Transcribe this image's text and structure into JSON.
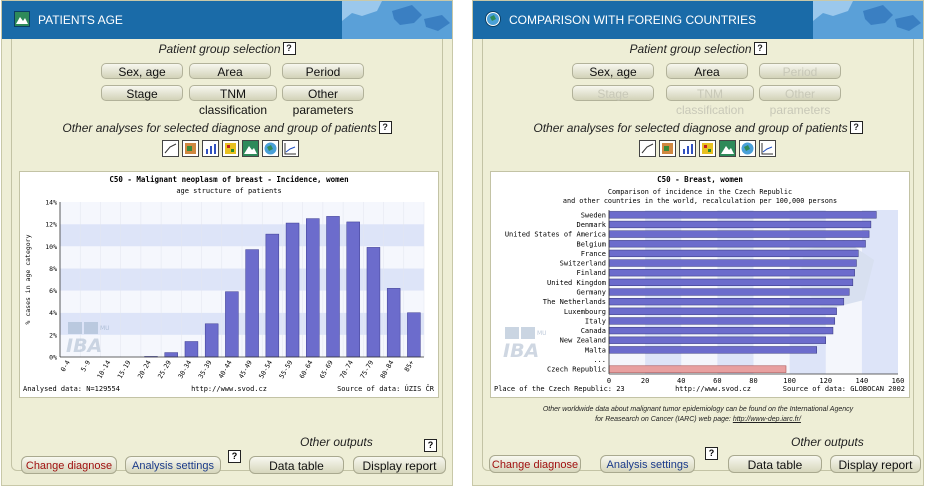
{
  "left": {
    "title": "PATIENTS AGE",
    "group_label": "Patient group selection",
    "group_buttons": [
      "Sex, age",
      "Area",
      "Period",
      "Stage",
      "TNM classification",
      "Other parameters"
    ],
    "analyses_label": "Other analyses for selected diagnose and group of patients",
    "footer": {
      "left": "Analysed data: N=129554",
      "center": "http://www.svod.cz",
      "right": "Source of data: ÚZIS ČR"
    },
    "outputs_label": "Other outputs",
    "buttons": {
      "change": "Change diagnose",
      "settings": "Analysis settings",
      "table": "Data table",
      "report": "Display report"
    }
  },
  "right": {
    "title": "COMPARISON WITH FOREING COUNTRIES",
    "group_label": "Patient group selection",
    "group_buttons": [
      "Sex, age",
      "Area",
      "Period",
      "Stage",
      "TNM classification",
      "Other parameters"
    ],
    "analyses_label": "Other analyses for selected diagnose and group of patients",
    "footer": {
      "left": "Place of the Czech Republic: 23",
      "center": "http://www.svod.cz",
      "right": "Source of data: GLOBOCAN 2002"
    },
    "note_line1": "Other worldwide data about malignant tumor epidemiology can be found on the International Agency",
    "note_line2": "for Reasearch on Cancer (IARC) web page:",
    "note_link": "http://www-dep.iarc.fr/",
    "outputs_label": "Other outputs",
    "buttons": {
      "change": "Change diagnose",
      "settings": "Analysis settings",
      "table": "Data table",
      "report": "Display report"
    }
  },
  "help_glyph": "?",
  "logo": {
    "big": "IBA",
    "small": "MU"
  },
  "colors": {
    "header": "#1a6ba8",
    "panel": "#eeeed6",
    "bar": "#6c6ccc",
    "czech_bar": "#e8a0a0",
    "band": "#dde4f8"
  },
  "chart_data": [
    {
      "type": "bar",
      "title": "C50 - Malignant neoplasm of breast - Incidence, women",
      "subtitle": "age structure of patients",
      "ylabel": "% cases in age category",
      "categories": [
        "0-4",
        "5-9",
        "10-14",
        "15-19",
        "20-24",
        "25-29",
        "30-34",
        "35-39",
        "40-44",
        "45-49",
        "50-54",
        "55-59",
        "60-64",
        "65-69",
        "70-74",
        "75-79",
        "80-84",
        "85+"
      ],
      "values": [
        0,
        0,
        0,
        0,
        0.05,
        0.4,
        1.4,
        3.0,
        5.9,
        9.7,
        11.1,
        12.1,
        12.5,
        12.7,
        12.2,
        9.9,
        6.2,
        4.0
      ],
      "yticks": [
        "0%",
        "2%",
        "4%",
        "6%",
        "8%",
        "10%",
        "12%",
        "14%"
      ],
      "ylim": [
        0,
        14
      ],
      "grid": true
    },
    {
      "type": "bar",
      "orientation": "horizontal",
      "title": "C50 - Breast, women",
      "subtitle_lines": [
        "Comparison of incidence in the Czech Republic",
        "and other countries in the world, recalculation per 100,000 persons"
      ],
      "categories": [
        "Sweden",
        "Denmark",
        "United States of America",
        "Belgium",
        "France",
        "Switzerland",
        "Finland",
        "United Kingdom",
        "Germany",
        "The Netherlands",
        "Luxembourg",
        "Italy",
        "Canada",
        "New Zealand",
        "Malta",
        "...",
        "Czech Republic"
      ],
      "values": [
        148,
        145,
        144,
        142,
        138,
        137,
        136,
        135,
        133,
        130,
        126,
        125,
        124,
        120,
        115,
        null,
        98
      ],
      "xticks": [
        "0",
        "20",
        "40",
        "60",
        "80",
        "100",
        "120",
        "140",
        "160"
      ],
      "xlim": [
        0,
        160
      ]
    }
  ]
}
